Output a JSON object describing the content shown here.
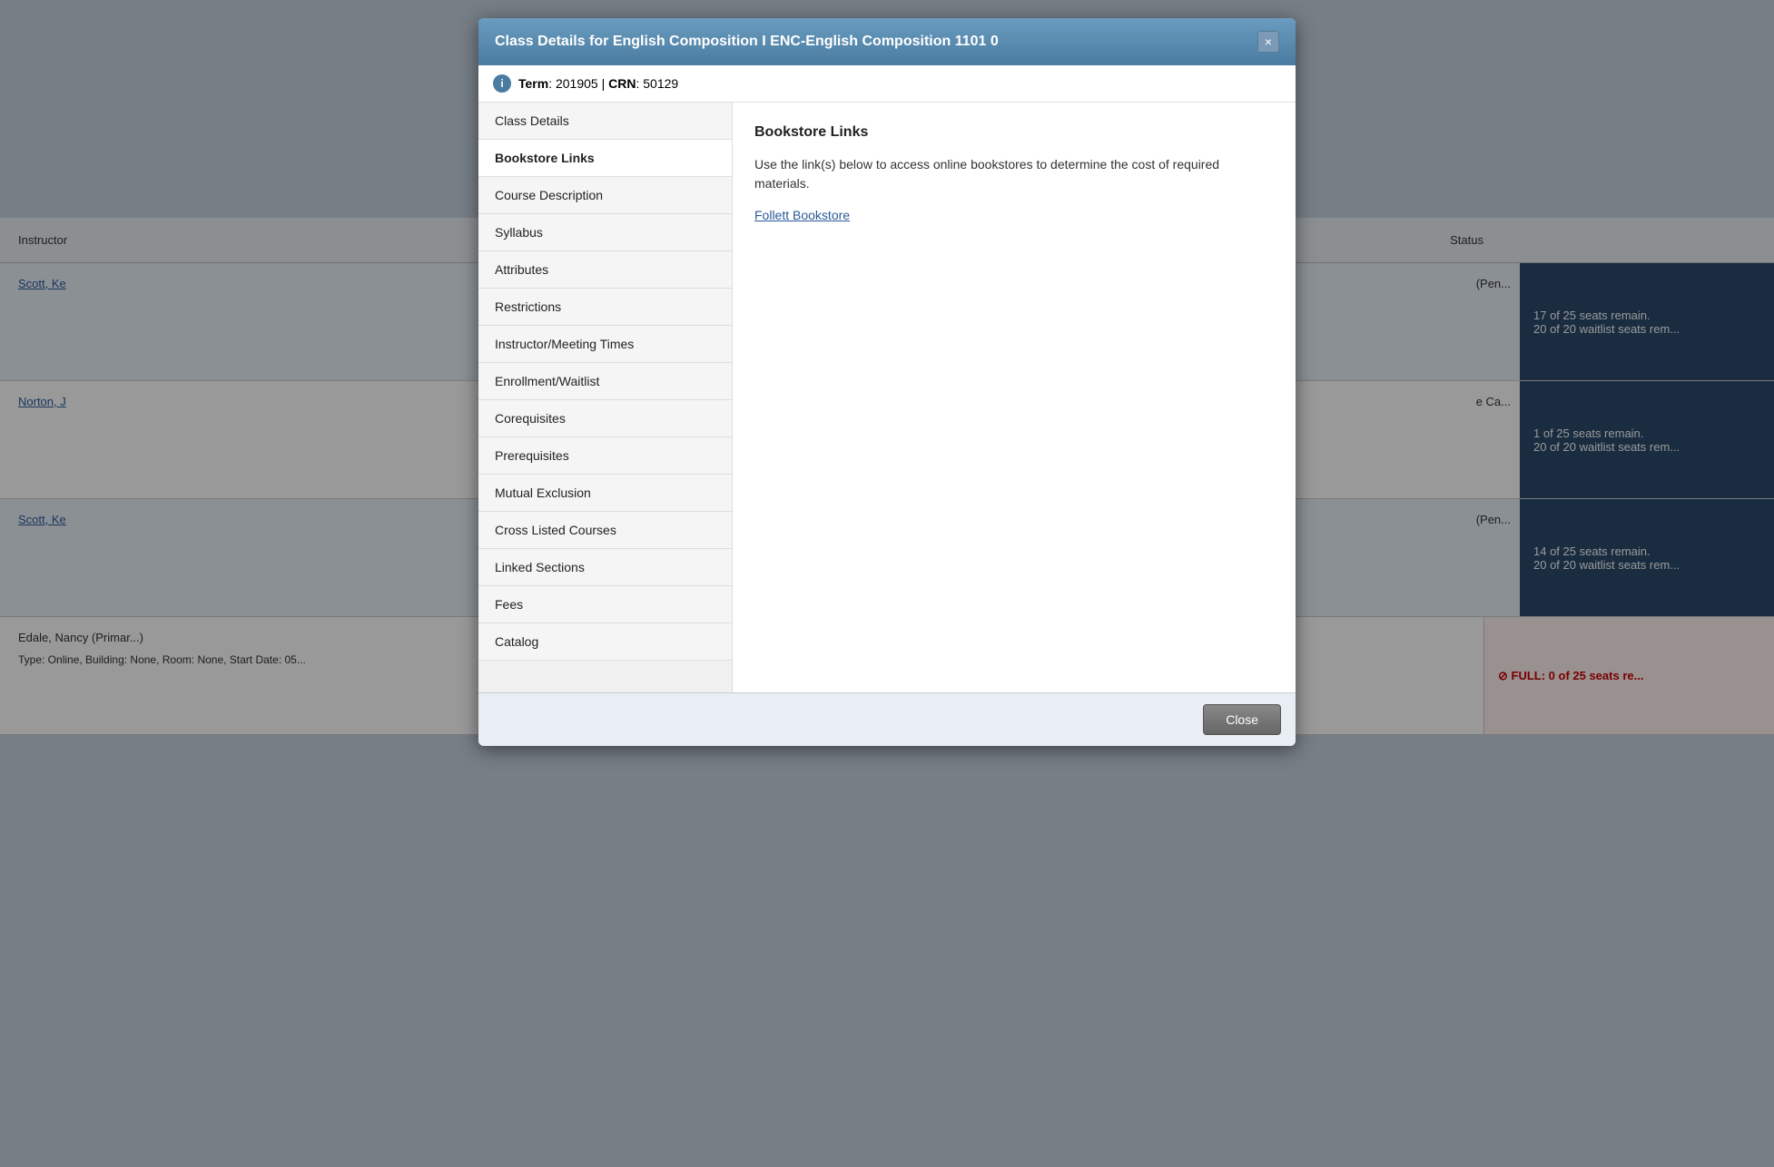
{
  "background": {
    "header_col": "Instructor",
    "status_col": "Status",
    "rows": [
      {
        "instructor": "Scott, Ke",
        "status_text1": "17 of 25 seats remain.",
        "status_text2": "20 of 20 waitlist seats rem...",
        "detail": "(Pen..."
      },
      {
        "instructor": "Norton, J",
        "status_text1": "1 of 25 seats remain.",
        "status_text2": "20 of 20 waitlist seats rem...",
        "detail": "e Ca..."
      },
      {
        "instructor": "Scott, Ke",
        "status_text1": "14 of 25 seats remain.",
        "status_text2": "20 of 20 waitlist seats rem...",
        "detail": "(Pen..."
      },
      {
        "instructor": "Edale, Nancy (Primar...)",
        "status_text1": "FULL: 0 of 25 seats re...",
        "status_text2": "",
        "detail": "Type: Online, Building: None, Room: None, Start Date: 05..."
      }
    ]
  },
  "modal": {
    "title": "Class Details for English Composition I ENC-English Composition 1101 0",
    "close_label": "×",
    "term_label": "Term",
    "term_value": "201905",
    "crn_label": "CRN",
    "crn_value": "50129",
    "nav_items": [
      {
        "id": "class-details",
        "label": "Class Details"
      },
      {
        "id": "bookstore-links",
        "label": "Bookstore Links"
      },
      {
        "id": "course-description",
        "label": "Course Description"
      },
      {
        "id": "syllabus",
        "label": "Syllabus"
      },
      {
        "id": "attributes",
        "label": "Attributes"
      },
      {
        "id": "restrictions",
        "label": "Restrictions"
      },
      {
        "id": "instructor-meeting-times",
        "label": "Instructor/Meeting Times"
      },
      {
        "id": "enrollment-waitlist",
        "label": "Enrollment/Waitlist"
      },
      {
        "id": "corequisites",
        "label": "Corequisites"
      },
      {
        "id": "prerequisites",
        "label": "Prerequisites"
      },
      {
        "id": "mutual-exclusion",
        "label": "Mutual Exclusion"
      },
      {
        "id": "cross-listed-courses",
        "label": "Cross Listed Courses"
      },
      {
        "id": "linked-sections",
        "label": "Linked Sections"
      },
      {
        "id": "fees",
        "label": "Fees"
      },
      {
        "id": "catalog",
        "label": "Catalog"
      }
    ],
    "content": {
      "active_tab": "bookstore-links",
      "bookstore_title": "Bookstore Links",
      "bookstore_description": "Use the link(s) below to access online bookstores to determine the cost of required materials.",
      "bookstore_link_label": "Follett Bookstore"
    },
    "footer": {
      "close_button_label": "Close"
    }
  }
}
